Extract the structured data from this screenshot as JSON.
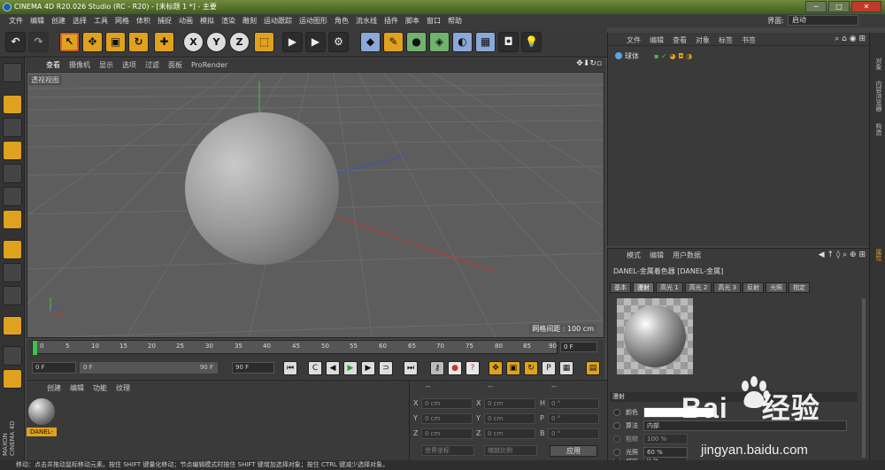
{
  "window": {
    "title": "CINEMA 4D R20.026 Studio (RC - R20) - [未标题 1 *] - 主要",
    "buttons": [
      "─",
      "□",
      "✕"
    ]
  },
  "menubar": {
    "items": [
      "文件",
      "编辑",
      "创建",
      "选择",
      "工具",
      "网格",
      "体积",
      "捕捉",
      "动画",
      "模拟",
      "渲染",
      "雕刻",
      "运动跟踪",
      "运动图形",
      "角色",
      "流水线",
      "插件",
      "脚本",
      "窗口",
      "帮助"
    ],
    "interface_label": "界面:",
    "interface_value": "启动"
  },
  "toolbar": {
    "axis_x": "X",
    "axis_y": "Y",
    "axis_z": "Z"
  },
  "viewport": {
    "menu": [
      "查看",
      "摄像机",
      "显示",
      "选项",
      "过滤",
      "面板",
      "ProRender"
    ],
    "label": "透视视图",
    "grid_spacing": "网格间距 : 100 cm"
  },
  "timeline": {
    "ticks": [
      "0",
      "5",
      "10",
      "15",
      "20",
      "25",
      "30",
      "35",
      "40",
      "45",
      "50",
      "55",
      "60",
      "65",
      "70",
      "75",
      "80",
      "85",
      "90"
    ],
    "current_frame": "0 F"
  },
  "transport": {
    "start": "0 F",
    "range_start": "0 F",
    "range_end": "90 F",
    "end": "90 F"
  },
  "material_panel": {
    "menu": [
      "创建",
      "编辑",
      "功能",
      "纹理"
    ],
    "material_name": "DANEL-"
  },
  "coords": {
    "header": [
      "--",
      "--",
      "--"
    ],
    "rows": [
      {
        "l1": "X",
        "v1": "0 cm",
        "l2": "X",
        "v2": "0 cm",
        "l3": "H",
        "v3": "0 °"
      },
      {
        "l1": "Y",
        "v1": "0 cm",
        "l2": "Y",
        "v2": "0 cm",
        "l3": "P",
        "v3": "0 °"
      },
      {
        "l1": "Z",
        "v1": "0 cm",
        "l2": "Z",
        "v2": "0 cm",
        "l3": "B",
        "v3": "0 °"
      }
    ],
    "mode": "世界坐标",
    "scale_mode": "缩放比例",
    "apply": "应用"
  },
  "object_panel": {
    "menu": [
      "文件",
      "编辑",
      "查看",
      "对象",
      "标签",
      "书签"
    ],
    "object_name": "球体"
  },
  "attr_panel": {
    "menu": [
      "模式",
      "编辑",
      "用户数据"
    ],
    "title": "DANEL-金属着色器 [DANEL-金属]",
    "tabs": [
      "基本",
      "漫射",
      "高光 1",
      "高光 2",
      "高光 3",
      "反射",
      "光照",
      "指定"
    ],
    "section": "漫射",
    "props": [
      {
        "label": "颜色",
        "value": ""
      },
      {
        "label": "算法",
        "value": "内部"
      },
      {
        "label": "粗糙",
        "value": "100 %"
      },
      {
        "label": "光照",
        "value": "60 %"
      },
      {
        "label": "对比",
        "value": "0 %"
      }
    ]
  },
  "right_tabs": [
    "对象",
    "内容浏览器",
    "构造",
    "属性"
  ],
  "status": "移动：点击并拖动鼠标移动元素。按住 SHIFT 键量化移动；节点编辑模式时按住 SHIFT 键增加选择对象；按住 CTRL 键减少选择对象。",
  "watermark": {
    "brand": "Bai",
    "brand2": "经验",
    "url": "jingyan.baidu.com"
  },
  "colors": {
    "accent": "#e0a21e",
    "green_axis": "#3ec34a",
    "red_axis": "#c0392b",
    "blue_axis": "#3b4fc9"
  }
}
